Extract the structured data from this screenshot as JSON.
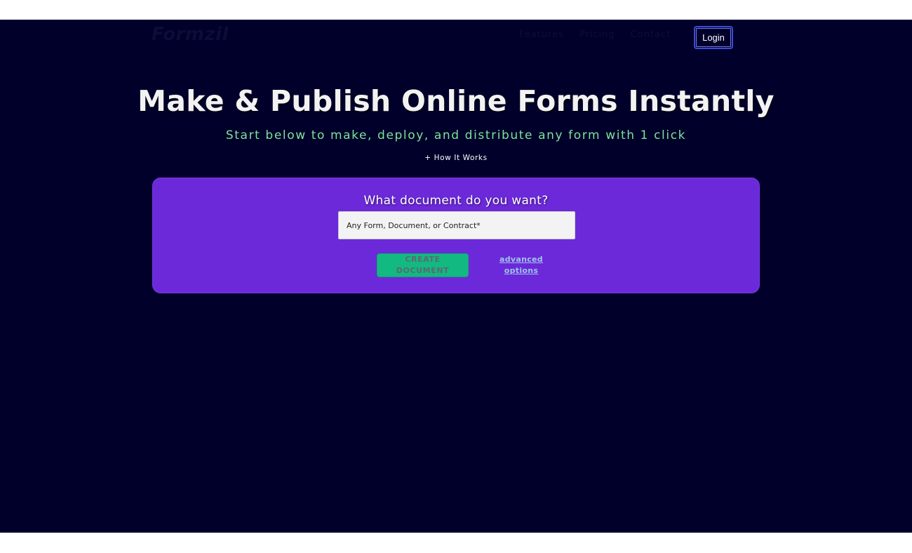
{
  "header": {
    "logo": "Formzil",
    "nav": [
      "Features",
      "Pricing",
      "Contact"
    ],
    "login_label": "Login"
  },
  "hero": {
    "title": "Make & Publish Online Forms Instantly",
    "subtitle": "Start below to make, deploy, and distribute any form with 1 click",
    "how_it_works": "+ How It Works"
  },
  "card": {
    "title": "What document do you want?",
    "input_placeholder": "Any Form, Document, or Contract*",
    "input_value": "",
    "create_label": "CREATE DOCUMENT",
    "advanced_label": "advanced options"
  },
  "colors": {
    "background": "#00002a",
    "card": "#6c29d9",
    "accent_green": "#12b981",
    "subtitle_green": "#7ee29b",
    "login_border": "#3a4bd6"
  }
}
